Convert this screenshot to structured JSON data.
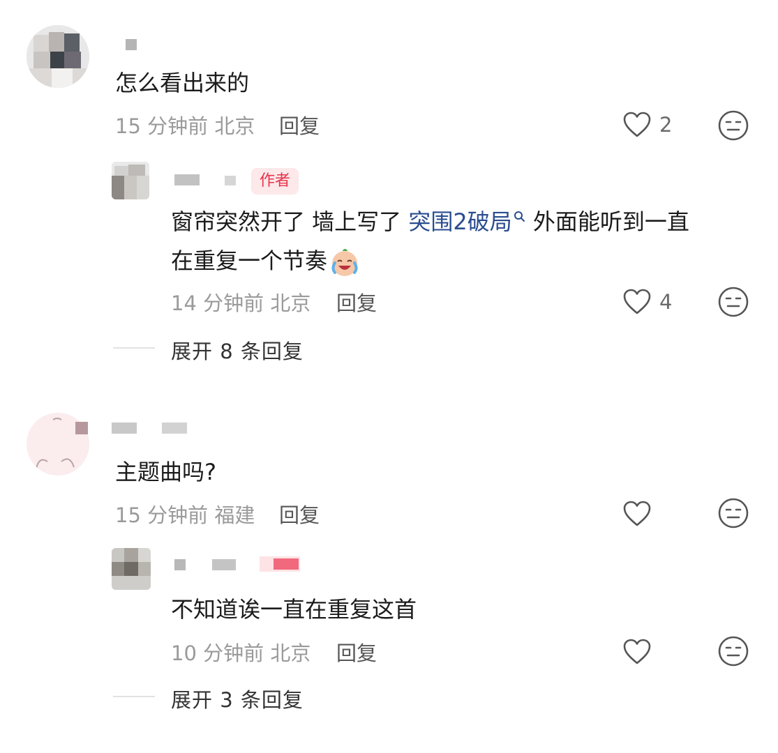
{
  "comments": [
    {
      "text": "怎么看出来的",
      "time": "15 分钟前",
      "location": "北京",
      "reply_label": "回复",
      "likes": "2",
      "reply": {
        "author_tag": "作者",
        "text_line1_prefix": "窗帘突然开了 墙上写了 ",
        "text_link": "突围2破局",
        "text_line1_suffix": " 外面能听到一直",
        "text_line2": "在重复一个节奏",
        "time": "14 分钟前",
        "location": "北京",
        "reply_label": "回复",
        "likes": "4"
      },
      "expand_label": "展开 8 条回复"
    },
    {
      "text": "主题曲吗?",
      "time": "15 分钟前",
      "location": "福建",
      "reply_label": "回复",
      "likes": "",
      "reply": {
        "text": "不知道诶一直在重复这首",
        "time": "10 分钟前",
        "location": "北京",
        "reply_label": "回复",
        "likes": ""
      },
      "expand_label": "展开 3 条回复"
    }
  ],
  "icons": {
    "like": "heart-outline-icon",
    "dislike": "neutral-face-icon",
    "search": "search-icon",
    "emoji": "laughing-crying-emoji"
  },
  "colors": {
    "author_tag_bg": "#fde8ea",
    "author_tag_text": "#e8334a",
    "link": "#2a4d8f"
  }
}
